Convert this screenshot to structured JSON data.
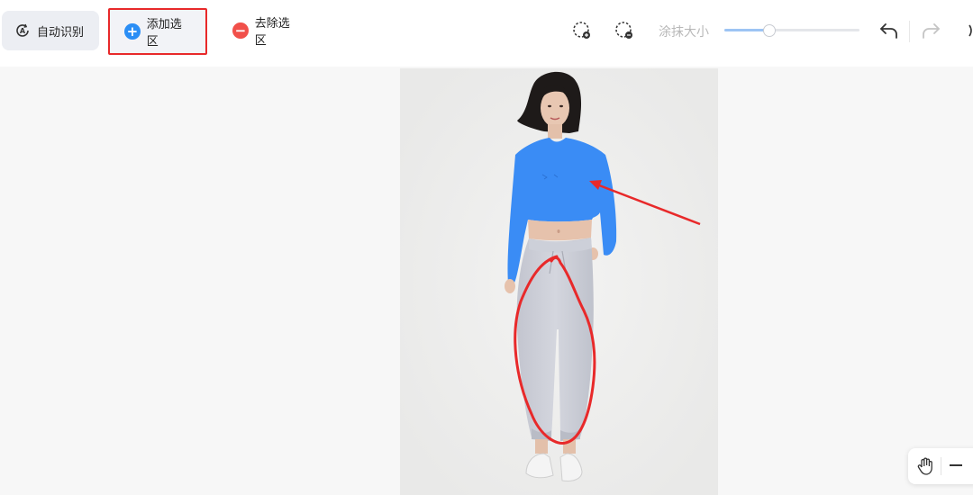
{
  "toolbar": {
    "auto_detect_label": "自动识别",
    "add_selection_label": "添加选区",
    "remove_selection_label": "去除选区",
    "brush_size_label": "涂抹大小",
    "brush_size_level": 0.33,
    "icons": {
      "auto_detect": "auto-detect-icon",
      "add": "plus-circle-icon",
      "remove": "minus-circle-icon",
      "lasso_add": "lasso-add-icon",
      "lasso_remove": "lasso-remove-icon",
      "undo": "undo-icon",
      "redo": "redo-icon"
    }
  },
  "canvas": {
    "image_subject": "photo-of-woman-in-cropped-top-and-jogger-pants",
    "selection_color": "#3a8cf5"
  },
  "zoom": {
    "icons": {
      "hand": "hand-icon",
      "zoom_out": "minus-icon"
    }
  },
  "colors": {
    "add_accent": "#2b8ef5",
    "remove_accent": "#f1504a",
    "annotation_red": "#e8292a"
  }
}
